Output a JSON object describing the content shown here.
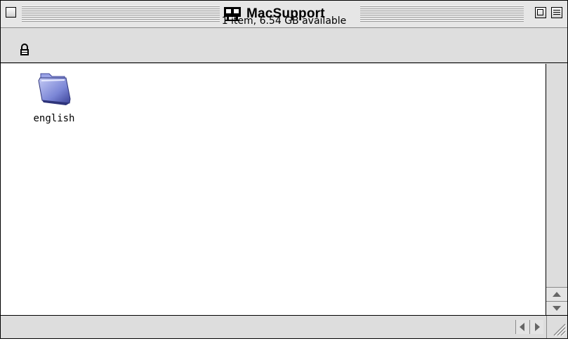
{
  "window": {
    "title": "MacSupport",
    "title_icon": "network-icon"
  },
  "infobar": {
    "status": "1 item, 6.54 GB available",
    "lock_icon": "lock-icon"
  },
  "items": [
    {
      "label": "english",
      "icon": "folder-icon"
    }
  ],
  "colors": {
    "folder": "#7b86d6",
    "chrome": "#dddddd"
  }
}
